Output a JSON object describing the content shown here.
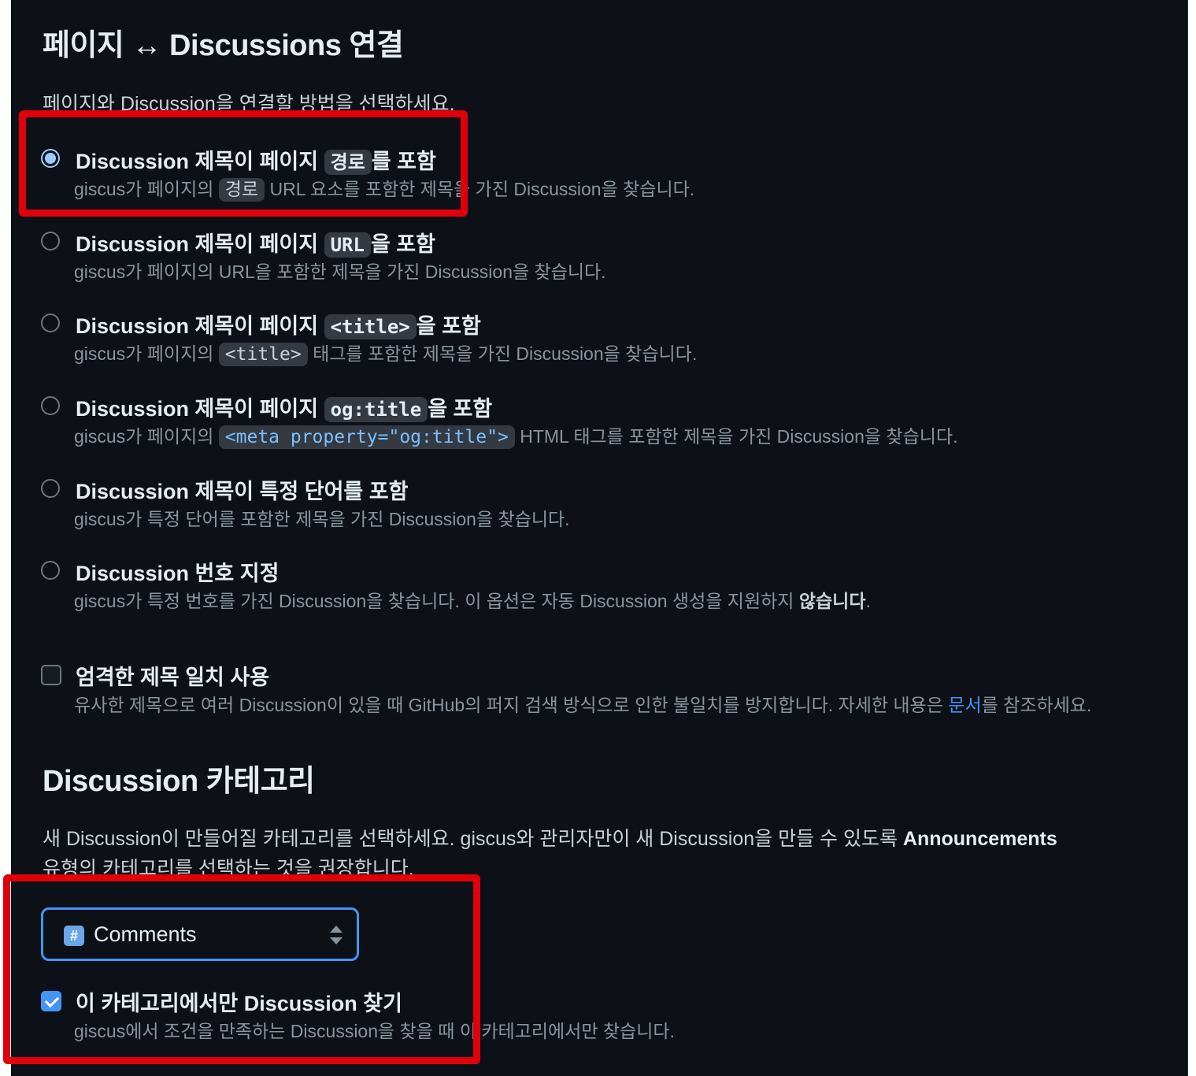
{
  "mapping": {
    "title": "페이지 ↔ Discussions 연결",
    "description": "페이지와 Discussion을 연결할 방법을 선택하세요.",
    "options": [
      {
        "label_pre": "Discussion 제목이 페이지",
        "label_code": "경로",
        "label_post": "를 포함",
        "sub_pre": "giscus가 페이지의",
        "sub_code": "경로",
        "sub_post": "URL 요소를 포함한 제목을 가진 Discussion을 찾습니다.",
        "checked": true
      },
      {
        "label_pre": "Discussion 제목이 페이지",
        "label_code": "URL",
        "label_post": "을 포함",
        "sub": "giscus가 페이지의 URL을 포함한 제목을 가진 Discussion을 찾습니다.",
        "checked": false
      },
      {
        "label_pre": "Discussion 제목이 페이지",
        "label_code": "<title>",
        "label_post": "을 포함",
        "sub_pre": "giscus가 페이지의",
        "sub_code": "<title>",
        "sub_post": "태그를 포함한 제목을 가진 Discussion을 찾습니다.",
        "checked": false
      },
      {
        "label_pre": "Discussion 제목이 페이지",
        "label_code": "og:title",
        "label_post": "을 포함",
        "sub_pre": "giscus가 페이지의",
        "sub_code": "<meta property=\"og:title\">",
        "sub_post": "HTML 태그를 포함한 제목을 가진 Discussion을 찾습니다.",
        "checked": false
      },
      {
        "label": "Discussion 제목이 특정 단어를 포함",
        "sub": "giscus가 특정 단어를 포함한 제목을 가진 Discussion을 찾습니다.",
        "checked": false
      },
      {
        "label": "Discussion 번호 지정",
        "sub_pre": "giscus가 특정 번호를 가진 Discussion을 찾습니다. 이 옵션은 자동 Discussion 생성을 지원하지",
        "sub_bold": "않습니다",
        "sub_post": ".",
        "checked": false
      }
    ],
    "strict": {
      "label": "엄격한 제목 일치 사용",
      "sub_pre": "유사한 제목으로 여러 Discussion이 있을 때 GitHub의 퍼지 검색 방식으로 인한 불일치를 방지합니다. 자세한 내용은",
      "sub_link": "문서",
      "sub_post": "를 참조하세요.",
      "checked": false
    }
  },
  "category": {
    "title": "Discussion 카테고리",
    "desc_pre": "새 Discussion이 만들어질 카테고리를 선택하세요. giscus와 관리자만이 새 Discussion을 만들 수 있도록",
    "desc_bold": "Announcements",
    "desc_line2": "유형의 카테고리를 선택하는 것을 권장합니다.",
    "select_icon": "#",
    "select_value": "Comments",
    "only_label": "이 카테고리에서만 Discussion 찾기",
    "only_sub": "giscus에서 조건을 만족하는 Discussion을 찾을 때 이 카테고리에서만 찾습니다.",
    "only_checked": true
  },
  "colors": {
    "background": "#0d1117",
    "accent": "#4493f8",
    "highlight_box": "#e0000b"
  }
}
